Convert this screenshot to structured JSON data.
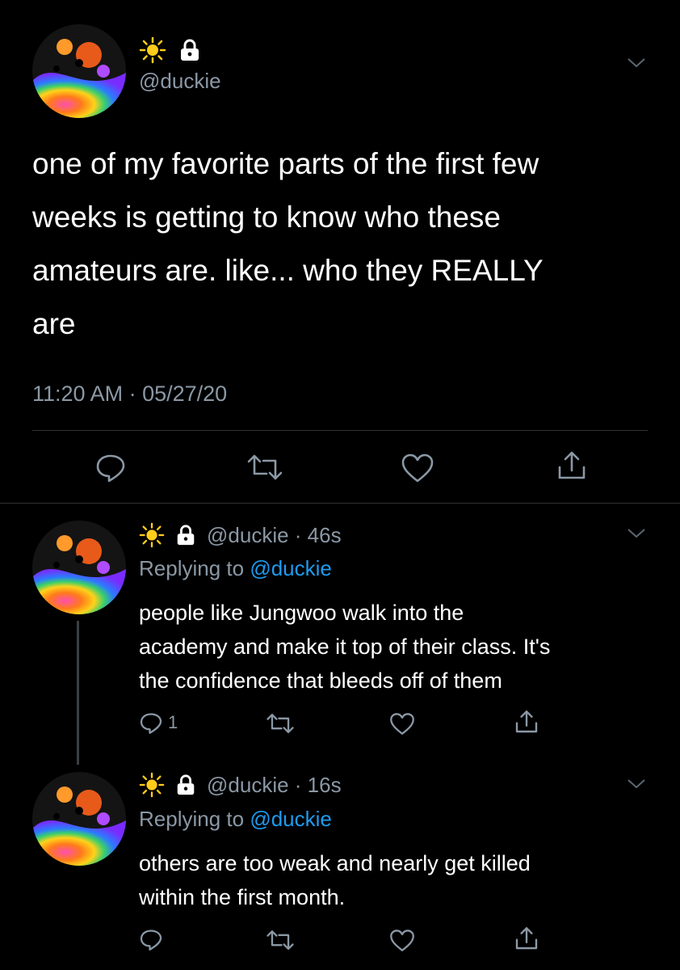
{
  "main_tweet": {
    "handle": "@duckie",
    "name_icons": [
      "sun-emoji-icon",
      "lock-emoji-icon"
    ],
    "text_lines": [
      "one of my favorite parts of the first few",
      "weeks is getting to know who these",
      "amateurs are. like... who they REALLY",
      "are"
    ],
    "timestamp": "11:20 AM · 05/27/20",
    "actions": [
      "reply-icon",
      "retweet-icon",
      "like-icon",
      "share-icon"
    ]
  },
  "replies": [
    {
      "handle_time": "@duckie · 46s",
      "replying_prefix": "Replying to ",
      "replying_handle": "@duckie",
      "text_lines": [
        "people like Jungwoo walk into the",
        "academy and make it top of their class. It's",
        "the confidence that bleeds off of them"
      ],
      "reply_count": "1"
    },
    {
      "handle_time": "@duckie · 16s",
      "replying_prefix": "Replying to ",
      "replying_handle": "@duckie",
      "text_lines": [
        "others are too weak and nearly get killed",
        "within the first month."
      ],
      "reply_count": ""
    }
  ],
  "colors": {
    "background": "#000000",
    "muted": "#8b98a5",
    "link": "#1d9bf0",
    "divider": "#2f3336"
  }
}
